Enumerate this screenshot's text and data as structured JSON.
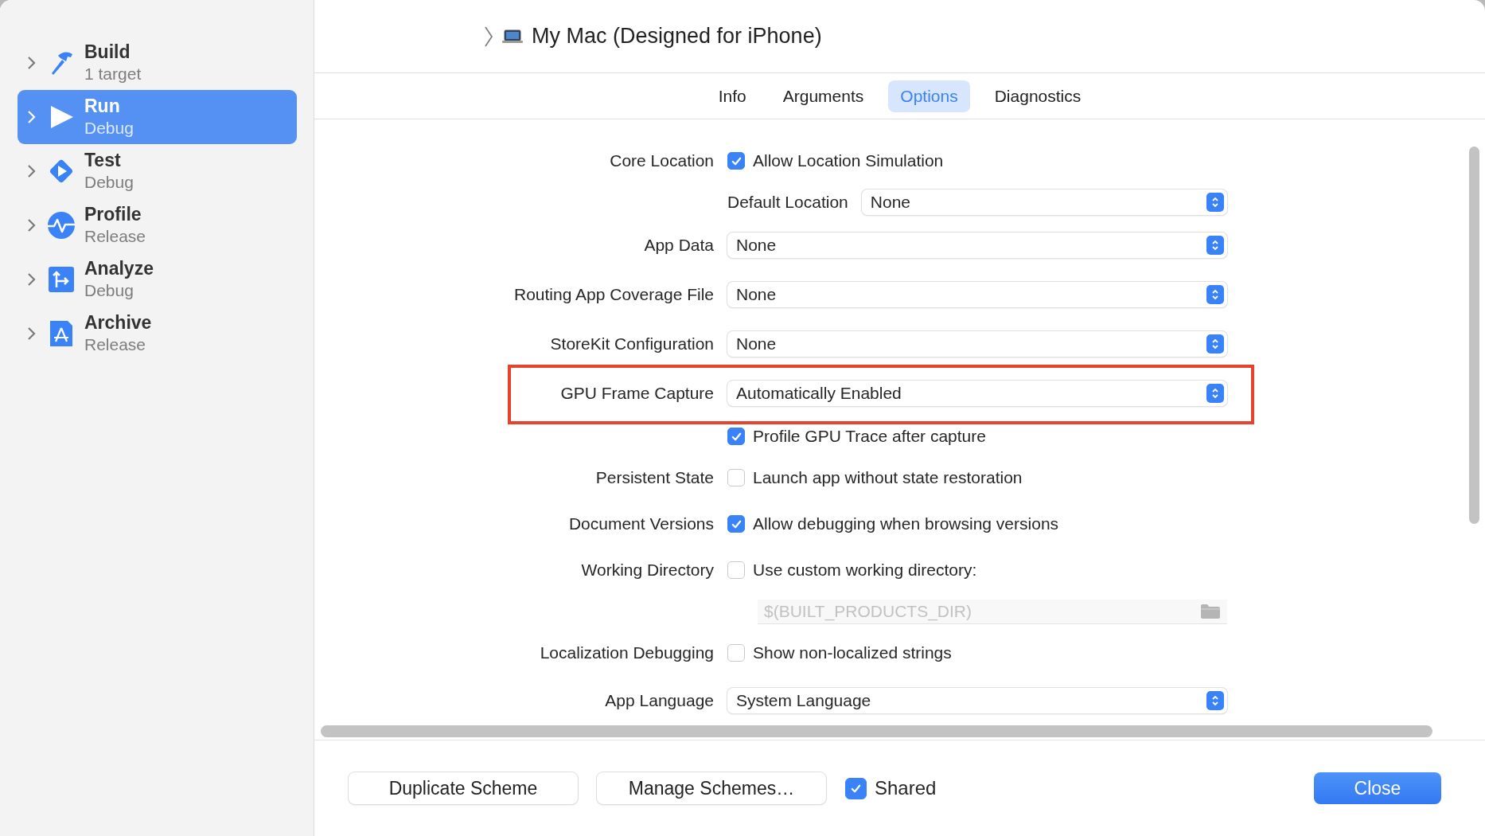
{
  "sidebar": {
    "items": [
      {
        "kind": "build",
        "title": "Build",
        "subtitle": "1 target",
        "selected": false
      },
      {
        "kind": "run",
        "title": "Run",
        "subtitle": "Debug",
        "selected": true
      },
      {
        "kind": "test",
        "title": "Test",
        "subtitle": "Debug",
        "selected": false
      },
      {
        "kind": "profile",
        "title": "Profile",
        "subtitle": "Release",
        "selected": false
      },
      {
        "kind": "analyze",
        "title": "Analyze",
        "subtitle": "Debug",
        "selected": false
      },
      {
        "kind": "archive",
        "title": "Archive",
        "subtitle": "Release",
        "selected": false
      }
    ]
  },
  "destination": {
    "title": "My Mac (Designed for iPhone)"
  },
  "tabs": [
    {
      "label": "Info",
      "selected": false
    },
    {
      "label": "Arguments",
      "selected": false
    },
    {
      "label": "Options",
      "selected": true
    },
    {
      "label": "Diagnostics",
      "selected": false
    }
  ],
  "options": [
    {
      "kind": "checkbox",
      "label": "Core Location",
      "text": "Allow Location Simulation",
      "checked": true,
      "highlighted": false
    },
    {
      "kind": "popup",
      "inline_label": "Default Location",
      "value": "None",
      "highlighted": false
    },
    {
      "kind": "popup",
      "label": "App Data",
      "value": "None",
      "highlighted": false
    },
    {
      "kind": "popup",
      "label": "Routing App Coverage File",
      "value": "None",
      "highlighted": false
    },
    {
      "kind": "popup",
      "label": "StoreKit Configuration",
      "value": "None",
      "highlighted": false
    },
    {
      "kind": "popup",
      "label": "GPU Frame Capture",
      "value": "Automatically Enabled",
      "highlighted": true
    },
    {
      "kind": "checkbox",
      "text": "Profile GPU Trace after capture",
      "checked": true,
      "highlighted": false
    },
    {
      "kind": "checkbox",
      "label": "Persistent State",
      "text": "Launch app without state restoration",
      "checked": false,
      "highlighted": false
    },
    {
      "kind": "checkbox",
      "label": "Document Versions",
      "text": "Allow debugging when browsing versions",
      "checked": true,
      "highlighted": false
    },
    {
      "kind": "checkbox",
      "label": "Working Directory",
      "text": "Use custom working directory:",
      "checked": false,
      "highlighted": false
    },
    {
      "kind": "path",
      "placeholder": "$(BUILT_PRODUCTS_DIR)",
      "disabled": true,
      "highlighted": false
    },
    {
      "kind": "checkbox",
      "label": "Localization Debugging",
      "text": "Show non-localized strings",
      "checked": false,
      "highlighted": false
    },
    {
      "kind": "popup",
      "label": "App Language",
      "value": "System Language",
      "highlighted": false
    }
  ],
  "footer": {
    "buttons": [
      {
        "label": "Duplicate Scheme"
      },
      {
        "label": "Manage Schemes…"
      }
    ],
    "shared": {
      "label": "Shared",
      "checked": true
    },
    "close_button": {
      "label": "Close"
    }
  }
}
